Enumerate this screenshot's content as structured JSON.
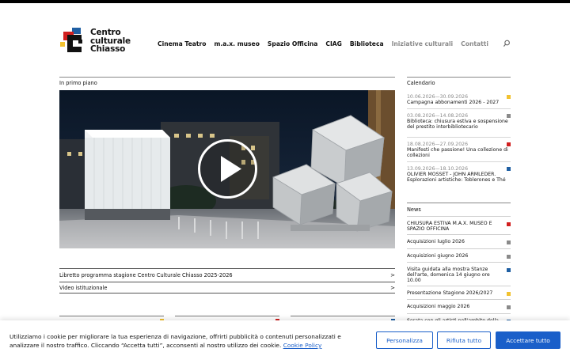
{
  "header": {
    "logo_lines": [
      "Centro",
      "culturale",
      "Chiasso"
    ],
    "nav": [
      {
        "label": "Cinema Teatro",
        "muted": false
      },
      {
        "label": "m.a.x. museo",
        "muted": false
      },
      {
        "label": "Spazio Officina",
        "muted": false
      },
      {
        "label": "CIAG",
        "muted": false
      },
      {
        "label": "Biblioteca",
        "muted": false
      },
      {
        "label": "Iniziative culturali",
        "muted": true
      },
      {
        "label": "Contatti",
        "muted": true
      }
    ],
    "search_icon": "search-icon"
  },
  "main": {
    "featured_label": "In primo piano",
    "links": [
      {
        "label": "Libretto programma stagione Centro Culturale Chiasso 2025-2026",
        "arrow": ">"
      },
      {
        "label": "Video istituzionale",
        "arrow": ">"
      }
    ],
    "play_icon": "play-icon"
  },
  "calendar": {
    "label": "Calendario",
    "items": [
      {
        "date": "10.06.2026—30.09.2026",
        "title": "Campagna abbonamenti 2026 - 2027",
        "color": "#f2c230"
      },
      {
        "date": "03.08.2026—14.08.2026",
        "title": "Biblioteca: chiusura estiva e sospensione del prestito interbibliotecario",
        "color": "#8a8a8a"
      },
      {
        "date": "18.08.2026—27.09.2026",
        "title": "Manifesti che passione! Una collezione di collezioni",
        "color": "#d11f1f"
      },
      {
        "date": "13.09.2026—18.10.2026",
        "title": "OLIVIER MOSSET - JOHN ARMLEDER. Esplorazioni artistiche: Toblerones e Thé",
        "color": "#1f5fa3"
      }
    ]
  },
  "news": {
    "label": "News",
    "items": [
      {
        "title": "CHIUSURA ESTIVA M.A.X. MUSEO E SPAZIO OFFICINA",
        "color": "#d11f1f"
      },
      {
        "title": "Acquisizioni luglio 2026",
        "color": "#8a8a8a"
      },
      {
        "title": "Acquisizioni giugno 2026",
        "color": "#8a8a8a"
      },
      {
        "title": "Visita guidata alla mostra Stanze dell'arte, domenica 14 giugno ore 10.00",
        "color": "#1f5fa3"
      },
      {
        "title": "Presentazione Stagione 2026/2027",
        "color": "#f2c230"
      },
      {
        "title": "Acquisizioni maggio 2026",
        "color": "#8a8a8a"
      },
      {
        "title": "Serata con gli artisti nell'ambito della",
        "color": "#1f5fa3"
      }
    ]
  },
  "cards": [
    {
      "color": "#f2c230"
    },
    {
      "color": "#d11f1f"
    },
    {
      "color": "#1f5fa3"
    }
  ],
  "cookie": {
    "text": "Utilizziamo i cookie per migliorare la tua esperienza di navigazione, offrirti pubblicità o contenuti personalizzati e analizzare il nostro traffico. Cliccando “Accetta tutti”, acconsenti al nostro utilizzo dei cookie.",
    "policy_link": "Cookie Policy",
    "buttons": {
      "customize": "Personalizza",
      "reject": "Rifiuta tutto",
      "accept": "Accettare tutto"
    }
  },
  "colors": {
    "accent": "#1a5fc9",
    "yellow": "#f2c230",
    "red": "#d11f1f",
    "blue": "#1f5fa3",
    "grey": "#8a8a8a"
  }
}
